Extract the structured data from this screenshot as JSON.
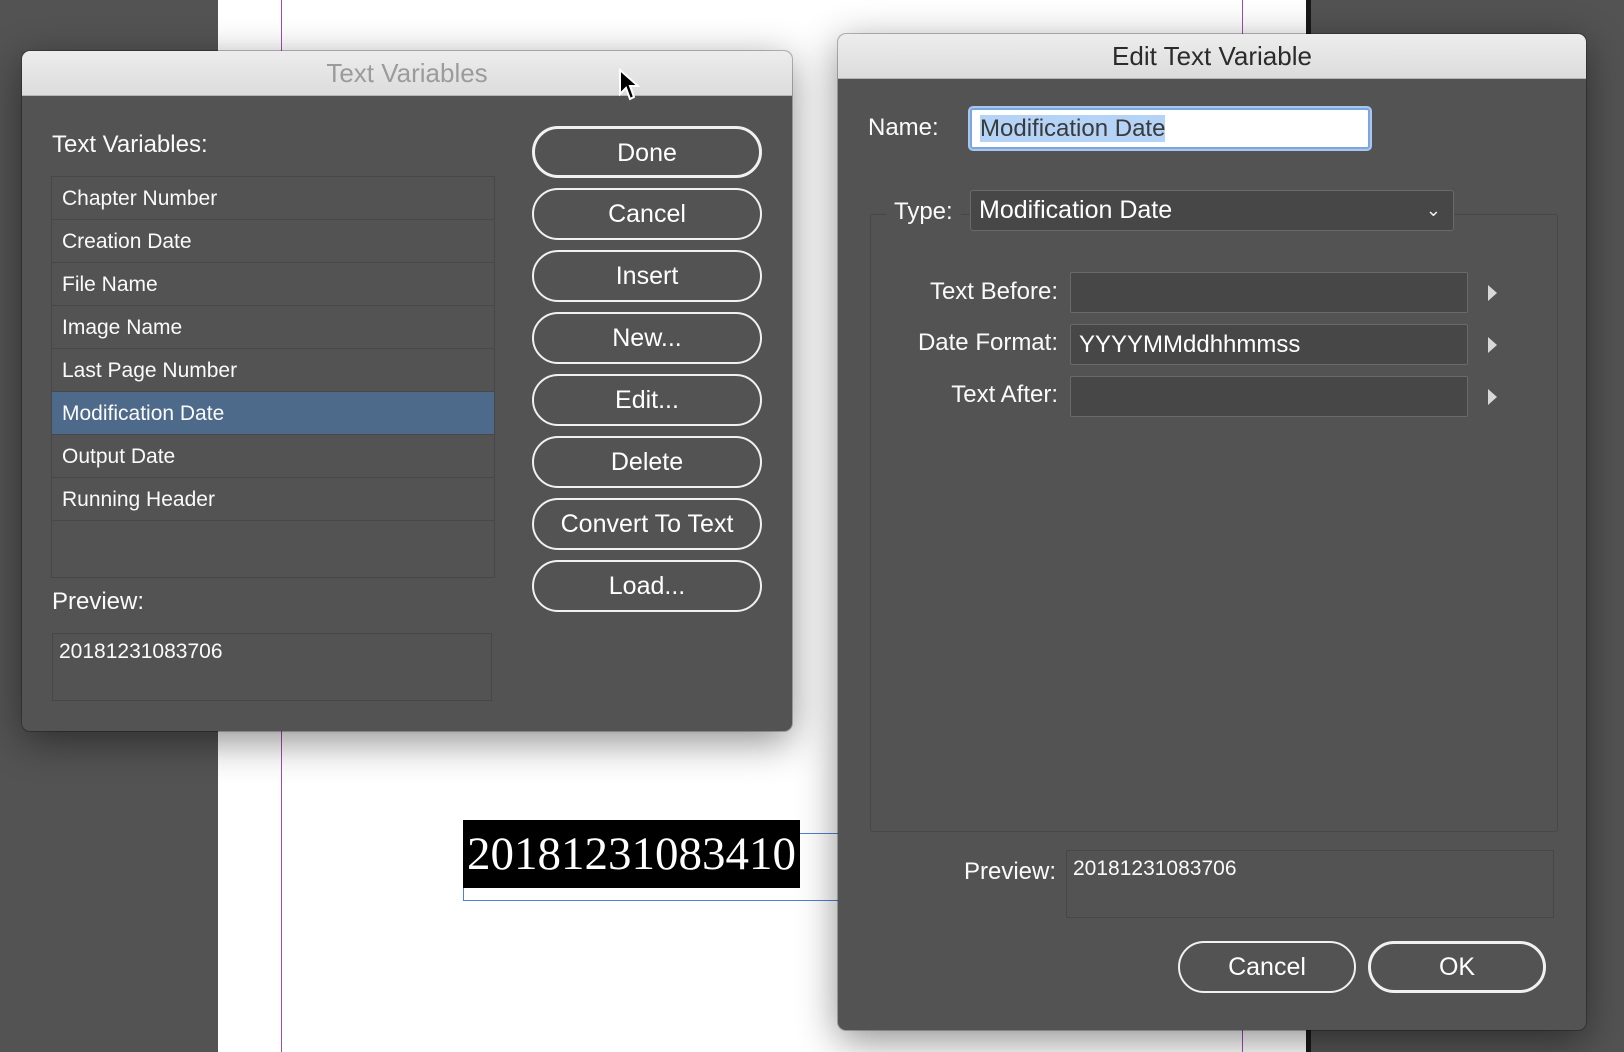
{
  "document": {
    "frame_text": "20181231083410"
  },
  "text_variables_dialog": {
    "title": "Text Variables",
    "list_label": "Text Variables:",
    "items": [
      {
        "label": "Chapter Number"
      },
      {
        "label": "Creation Date"
      },
      {
        "label": "File Name"
      },
      {
        "label": "Image Name"
      },
      {
        "label": "Last Page Number"
      },
      {
        "label": "Modification Date",
        "selected": true
      },
      {
        "label": "Output Date"
      },
      {
        "label": "Running Header"
      }
    ],
    "preview_label": "Preview:",
    "preview_value": "20181231083706",
    "buttons": {
      "done": "Done",
      "cancel": "Cancel",
      "insert": "Insert",
      "new": "New...",
      "edit": "Edit...",
      "delete": "Delete",
      "convert": "Convert To Text",
      "load": "Load..."
    }
  },
  "edit_dialog": {
    "title": "Edit Text Variable",
    "name_label": "Name:",
    "name_value": "Modification Date",
    "type_label": "Type:",
    "type_value": "Modification Date",
    "text_before_label": "Text Before:",
    "text_before_value": "",
    "date_format_label": "Date Format:",
    "date_format_value": "YYYYMMddhhmmss",
    "text_after_label": "Text After:",
    "text_after_value": "",
    "preview_label": "Preview:",
    "preview_value": "20181231083706",
    "cancel_label": "Cancel",
    "ok_label": "OK"
  },
  "colors": {
    "panel": "#535353",
    "selection": "#4d6a8a",
    "guide": "#a44bb3"
  },
  "icons": [
    "mouse-pointer-icon",
    "chevron-down-icon",
    "triangle-right-icon"
  ]
}
